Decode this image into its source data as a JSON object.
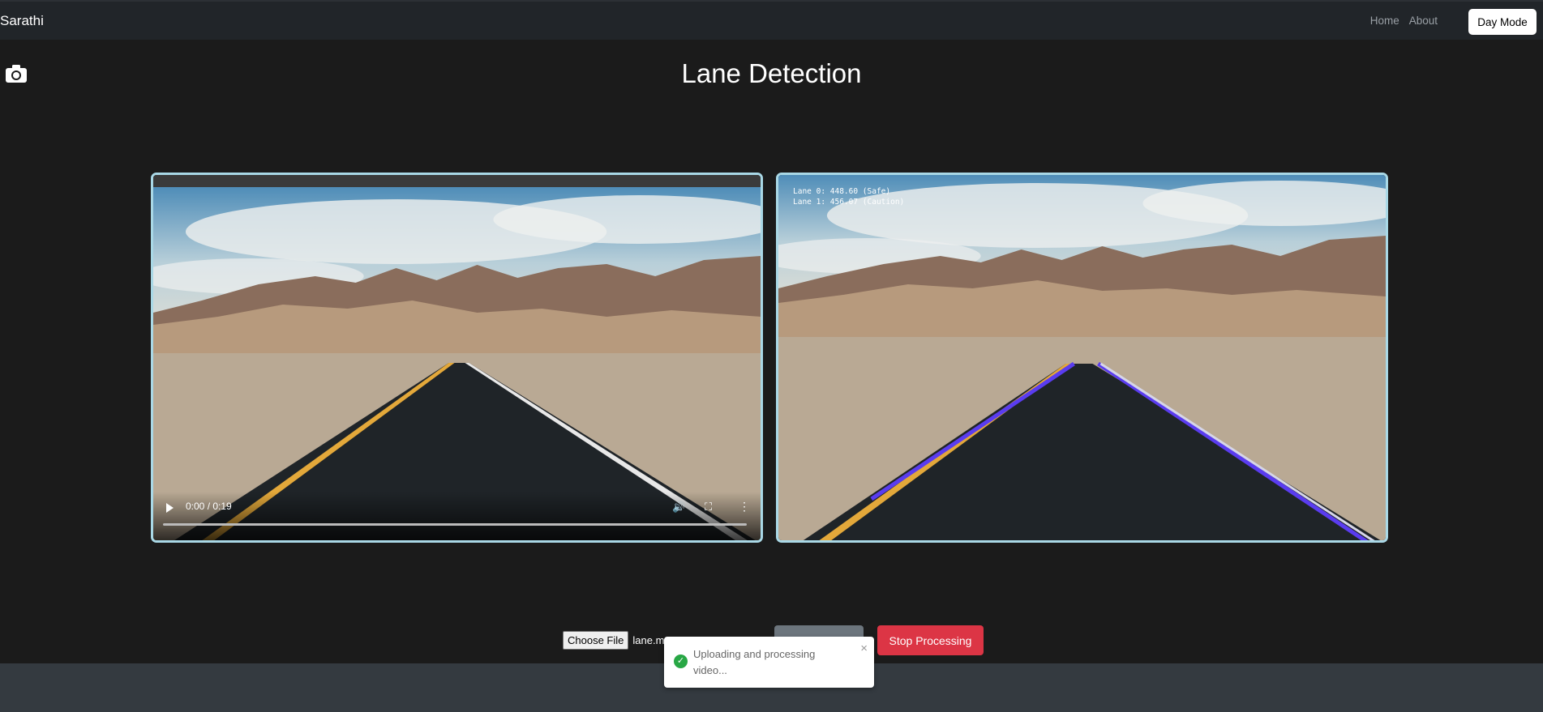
{
  "navbar": {
    "brand": "Sarathi",
    "links": [
      "Home",
      "About"
    ],
    "mode_button": "Day Mode"
  },
  "page": {
    "title": "Lane Detection"
  },
  "video_left": {
    "time": "0:00 / 0:19",
    "progress": 0
  },
  "video_right": {
    "overlay_lines": [
      "Lane 0: 448.60 (Safe)",
      "Lane 1: 456.07 (Caution)"
    ]
  },
  "upload": {
    "choose_label": "Choose File",
    "file_name": "lane.m",
    "process_label": "",
    "stop_label": "Stop Processing"
  },
  "toast": {
    "message": "Uploading and processing video...",
    "close": "×"
  },
  "colors": {
    "accent_border": "#a9d8e6",
    "danger": "#dc3545",
    "success": "#28a745"
  }
}
